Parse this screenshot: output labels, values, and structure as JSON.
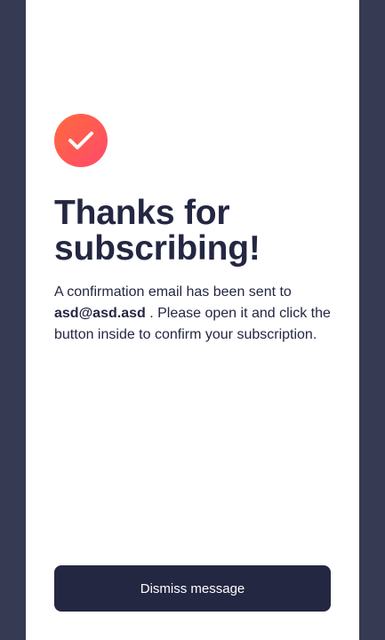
{
  "success": {
    "icon": "check-icon",
    "title": "Thanks for subscribing!",
    "message_before": "A confirmation email has been sent to",
    "email": "asd@asd.asd",
    "message_after": ". Please open it and click the button inside to confirm your subscription.",
    "dismiss_label": "Dismiss message"
  },
  "colors": {
    "background": "#363a52",
    "card": "#ffffff",
    "text": "#242742",
    "button": "#242742",
    "icon_gradient_start": "#ff6a3d",
    "icon_gradient_end": "#ff4a6b"
  }
}
